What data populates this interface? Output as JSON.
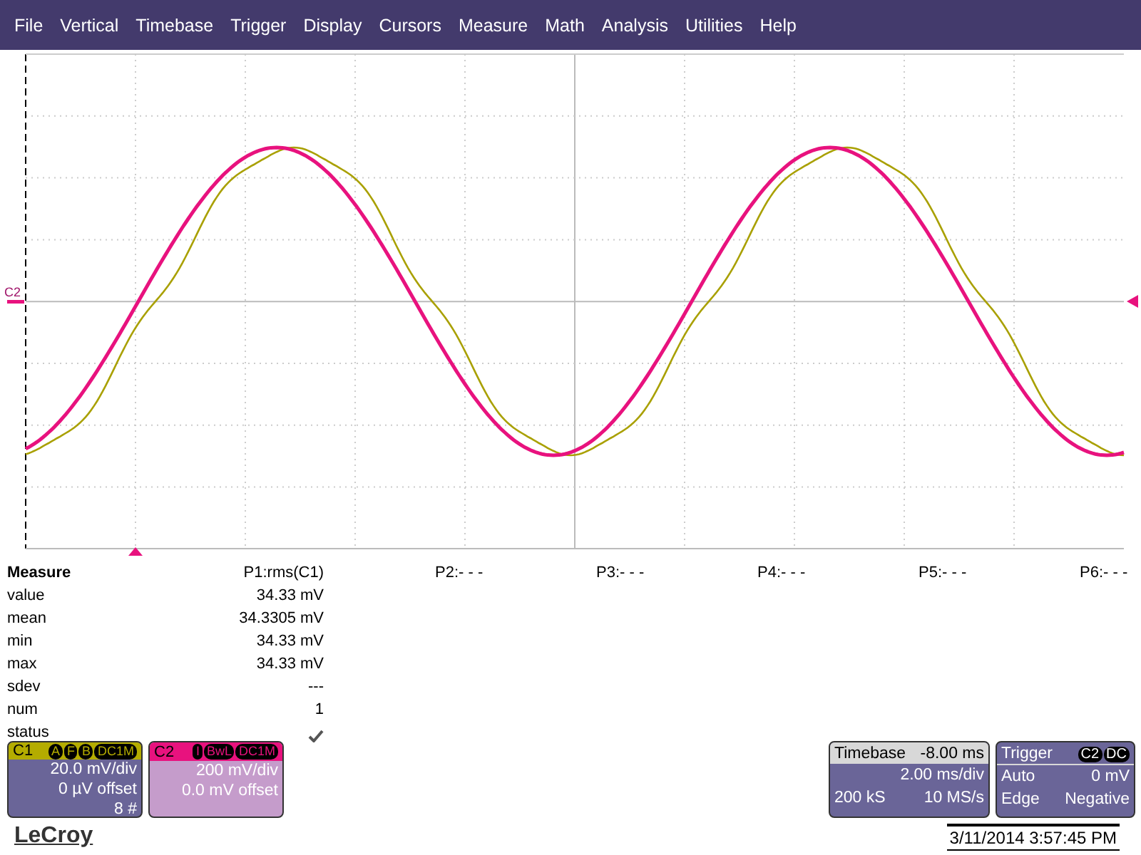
{
  "menu": [
    "File",
    "Vertical",
    "Timebase",
    "Trigger",
    "Display",
    "Cursors",
    "Measure",
    "Math",
    "Analysis",
    "Utilities",
    "Help"
  ],
  "graph": {
    "channel_marker": "C2"
  },
  "measure": {
    "title": "Measure",
    "columns": [
      "P1:rms(C1)",
      "P2:- - -",
      "P3:- - -",
      "P4:- - -",
      "P5:- - -",
      "P6:- - -"
    ],
    "rows": [
      {
        "label": "value",
        "value": "34.33 mV"
      },
      {
        "label": "mean",
        "value": "34.3305 mV"
      },
      {
        "label": "min",
        "value": "34.33 mV"
      },
      {
        "label": "max",
        "value": "34.33 mV"
      },
      {
        "label": "sdev",
        "value": "---"
      },
      {
        "label": "num",
        "value": "1"
      },
      {
        "label": "status",
        "kind": "check"
      }
    ]
  },
  "channels": [
    {
      "name": "C1",
      "color": "#b4ac00",
      "tags": [
        "A",
        "F",
        "B",
        "DC1M"
      ],
      "lines": [
        "20.0 mV/div",
        "0 µV offset",
        "8 #"
      ]
    },
    {
      "name": "C2",
      "color": "#e8127e",
      "tags": [
        "I",
        "BwL",
        "DC1M"
      ],
      "lines": [
        "200 mV/div",
        "0.0 mV offset"
      ]
    }
  ],
  "timebase": {
    "title": "Timebase",
    "delay": "-8.00 ms",
    "scale": "2.00 ms/div",
    "samples": "200 kS",
    "rate": "10 MS/s"
  },
  "trigger": {
    "title": "Trigger",
    "tags": [
      "C2",
      "DC"
    ],
    "mode": "Auto",
    "level": "0 mV",
    "type": "Edge",
    "slope": "Negative"
  },
  "logo": "LeCroy",
  "datetime": "3/11/2014 3:57:45 PM"
}
